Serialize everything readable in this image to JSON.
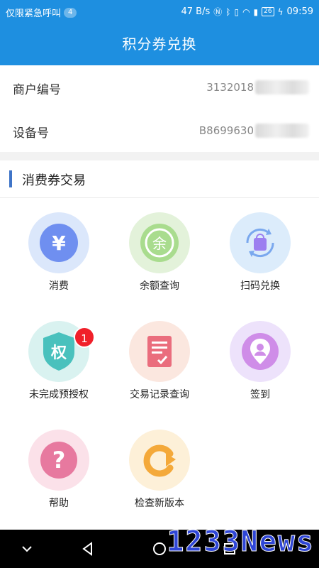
{
  "status_bar": {
    "carrier_text": "仅限紧急呼叫",
    "notification_count": "4",
    "network_speed": "47 B/s",
    "battery": "26",
    "time": "09:59"
  },
  "header": {
    "title": "积分券兑换"
  },
  "info": {
    "merchant_label": "商户编号",
    "merchant_value": "3132018",
    "device_label": "设备号",
    "device_value": "B8699630"
  },
  "section": {
    "title": "消费券交易"
  },
  "grid": {
    "items": [
      {
        "label": "消费",
        "icon": "yuan-icon"
      },
      {
        "label": "余额查询",
        "icon": "balance-icon"
      },
      {
        "label": "扫码兑换",
        "icon": "scan-exchange-icon"
      },
      {
        "label": "未完成预授权",
        "icon": "pre-auth-shield-icon",
        "badge": "1"
      },
      {
        "label": "交易记录查询",
        "icon": "record-doc-icon"
      },
      {
        "label": "签到",
        "icon": "check-in-pin-icon"
      },
      {
        "label": "帮助",
        "icon": "help-question-icon"
      },
      {
        "label": "检查新版本",
        "icon": "update-arrow-icon"
      }
    ]
  },
  "icon_text": {
    "yuan": "¥",
    "balance": "余",
    "pre_auth": "权",
    "help": "?"
  },
  "nav": [
    "back",
    "home",
    "recent",
    "down"
  ],
  "watermark": "1233News",
  "colors": {
    "primary": "#1e8fe0",
    "section_bar": "#3f74c7",
    "badge_red": "#f0202a"
  }
}
